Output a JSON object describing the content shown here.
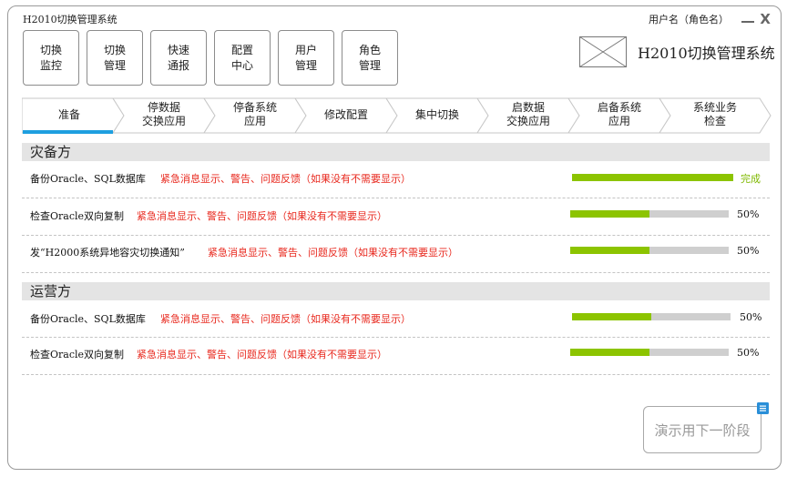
{
  "app": {
    "title": "H2010切换管理系统",
    "user_name": "用户名（角色名）",
    "close_glyph": "X"
  },
  "toolbar": {
    "buttons": [
      {
        "label": "切换\n监控"
      },
      {
        "label": "切换\n管理"
      },
      {
        "label": "快速\n通报"
      },
      {
        "label": "配置\n中心"
      },
      {
        "label": "用户\n管理"
      },
      {
        "label": "角色\n管理"
      }
    ]
  },
  "logo": {
    "text": "H2010切换管理系统",
    "image_icon": "image-placeholder-icon"
  },
  "steps": {
    "active_index": 0,
    "items": [
      {
        "label": "准备"
      },
      {
        "label": "停数据\n交换应用"
      },
      {
        "label": "停备系统\n应用"
      },
      {
        "label": "修改配置"
      },
      {
        "label": "集中切换"
      },
      {
        "label": "启数据\n交换应用"
      },
      {
        "label": "启备系统\n应用"
      },
      {
        "label": "系统业务\n检查"
      }
    ]
  },
  "sections": {
    "disaster": {
      "title": "灾备方",
      "rows": [
        {
          "label": "备份Oracle、SQL数据库",
          "message": "紧急消息显示、警告、问题反馈（如果没有不需要显示）",
          "progress": 1.0,
          "status": "完成"
        },
        {
          "label": "检查Oracle双向复制",
          "message": "紧急消息显示、警告、问题反馈（如果没有不需要显示）",
          "progress": 0.5,
          "status": "50%"
        },
        {
          "label": "发“H2000系统异地容灾切换通知”",
          "message": "紧急消息显示、警告、问题反馈（如果没有不需要显示）",
          "progress": 0.5,
          "status": "50%"
        }
      ]
    },
    "operations": {
      "title": "运营方",
      "rows": [
        {
          "label": "备份Oracle、SQL数据库",
          "message": "紧急消息显示、警告、问题反馈（如果没有不需要显示）",
          "progress": 0.5,
          "status": "50%"
        },
        {
          "label": "检查Oracle双向复制",
          "message": "紧急消息显示、警告、问题反馈（如果没有不需要显示）",
          "progress": 0.5,
          "status": "50%"
        }
      ]
    }
  },
  "next_button": {
    "label": "演示用下一阶段",
    "note_icon": "note-icon"
  },
  "colors": {
    "progress": "#8cc400",
    "alert": "#e8281e",
    "active_step": "#1e9fe0",
    "done": "#7fb800"
  }
}
